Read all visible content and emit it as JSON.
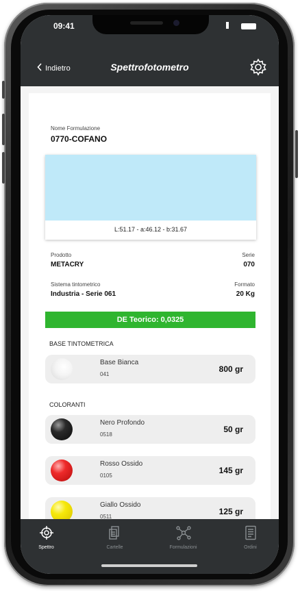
{
  "status_bar": {
    "time": "09:41"
  },
  "header": {
    "back_label": "Indietro",
    "title": "Spettrofotometro",
    "settings_icon": "gear-icon"
  },
  "formulation": {
    "name_label": "Nome Formulazione",
    "name_value": "0770-COFANO",
    "swatch_color": "#bfe9f9",
    "lab_values": "L:51.17 - a:46.12 - b:31.67"
  },
  "product": {
    "prodotto_label": "Prodotto",
    "prodotto_value": "METACRY",
    "serie_label": "Serie",
    "serie_value": "070",
    "sistema_label": "Sistema tintometrico",
    "sistema_value": "Industria - Serie 061",
    "formato_label": "Formato",
    "formato_value": "20 Kg"
  },
  "de_bar": {
    "label": "DE Teorico: 0,0325",
    "color": "#2fb52f"
  },
  "base": {
    "section_title": "BASE TINTOMETRICA",
    "items": [
      {
        "name": "Base Bianca",
        "code": "041",
        "qty": "800 gr",
        "color": "#f2f2f2"
      }
    ]
  },
  "colorants": {
    "section_title": "COLORANTI",
    "items": [
      {
        "name": "Nero Profondo",
        "code": "0518",
        "qty": "50 gr",
        "color": "#1a1a1a"
      },
      {
        "name": "Rosso Ossido",
        "code": "0105",
        "qty": "145 gr",
        "color": "#e11b1b"
      },
      {
        "name": "Giallo Ossido",
        "code": "0511",
        "qty": "125 gr",
        "color": "#f2e400"
      }
    ]
  },
  "tabs": [
    {
      "label": "Spettro",
      "icon": "target-icon",
      "active": true
    },
    {
      "label": "Cartelle",
      "icon": "folders-icon",
      "active": false
    },
    {
      "label": "Formulazioni",
      "icon": "molecule-icon",
      "active": false
    },
    {
      "label": "Ordini",
      "icon": "document-icon",
      "active": false
    }
  ],
  "colors": {
    "bar_background": "#2e3133",
    "accent_green": "#2fb52f"
  }
}
